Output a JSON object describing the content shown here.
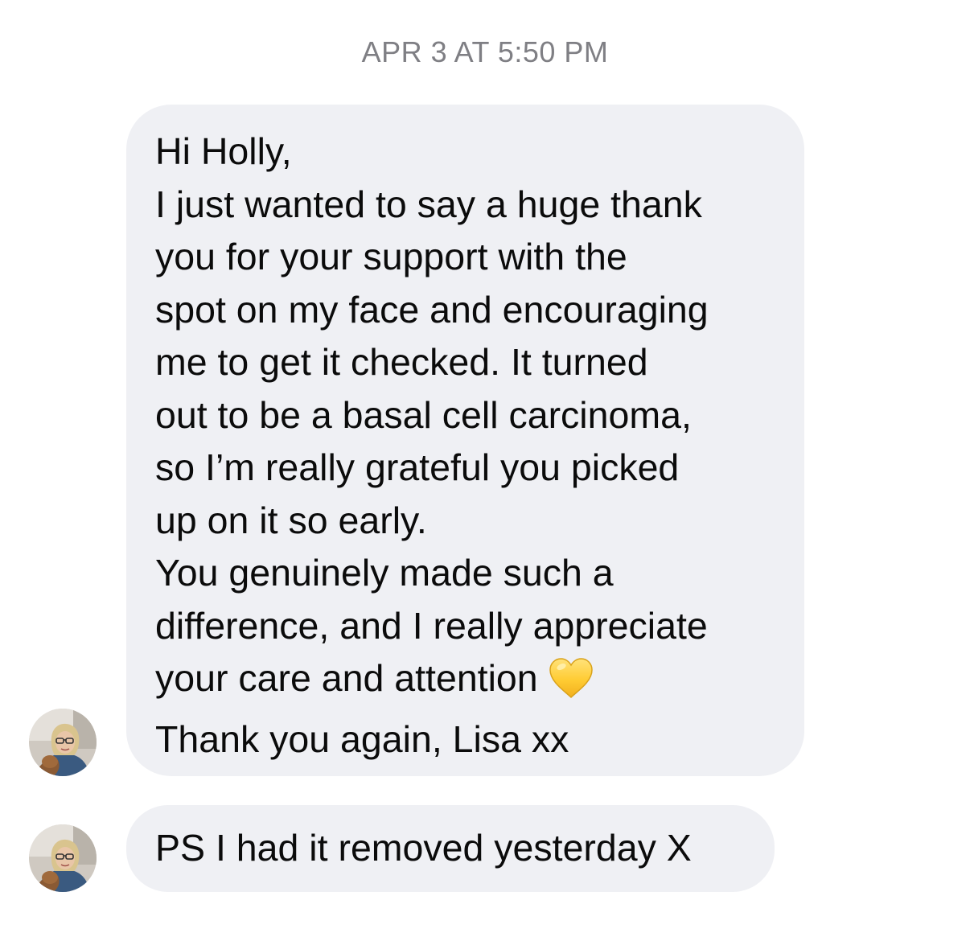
{
  "conversation": {
    "timestamp": "APR 3 AT 5:50 PM",
    "messages": [
      {
        "lines": [
          "Hi Holly,",
          "I just wanted to say a huge thank",
          "you for your support with the",
          "spot on my face and encouraging",
          "me to get it checked. It turned",
          "out to be a basal cell carcinoma,",
          "so I’m really grateful you picked",
          "up on it so early.",
          "You genuinely made such a",
          "difference, and I really appreciate",
          "your care and attention",
          "Thank you again, Lisa xx"
        ],
        "emoji": "yellow-heart-icon"
      },
      {
        "lines": [
          "PS  I had it removed yesterday X"
        ]
      }
    ]
  },
  "colors": {
    "bubble": "#eff0f4",
    "timestamp": "#7f7f84",
    "heart": "#ffcc33"
  }
}
